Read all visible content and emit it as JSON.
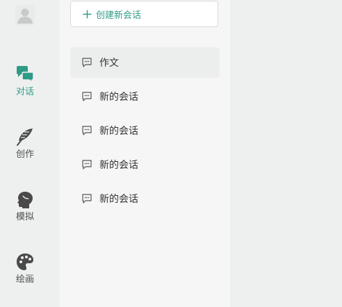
{
  "colors": {
    "accent": "#2f9b87",
    "icon_gray": "#4a4a4a",
    "text": "#333333"
  },
  "rail": {
    "avatar_icon": "user-avatar-icon",
    "items": [
      {
        "label": "对话",
        "icon": "chat-bubbles-icon",
        "active": true
      },
      {
        "label": "创作",
        "icon": "feather-icon",
        "active": false
      },
      {
        "label": "模拟",
        "icon": "head-profile-icon",
        "active": false
      },
      {
        "label": "绘画",
        "icon": "palette-icon",
        "active": false
      }
    ]
  },
  "conversations": {
    "new_button_label": "创建新会话",
    "items": [
      {
        "title": "作文",
        "active": true
      },
      {
        "title": "新的会话",
        "active": false
      },
      {
        "title": "新的会话",
        "active": false
      },
      {
        "title": "新的会话",
        "active": false
      },
      {
        "title": "新的会话",
        "active": false
      }
    ]
  }
}
